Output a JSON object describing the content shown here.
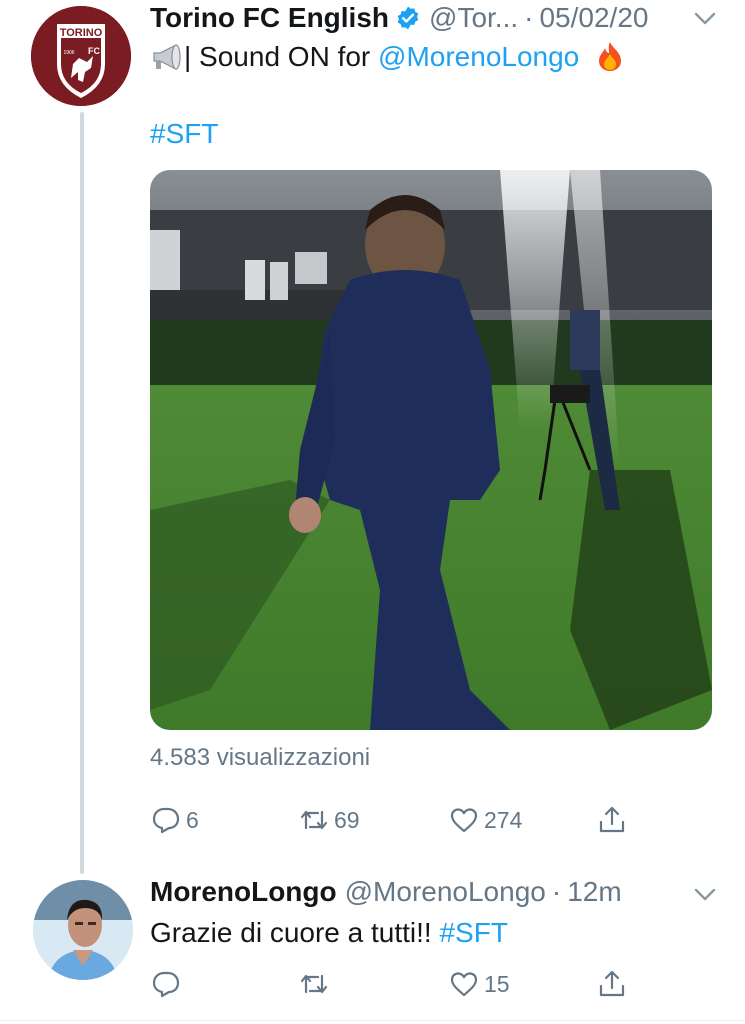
{
  "tweet1": {
    "display_name": "Torino FC English",
    "handle": "@Tor...",
    "date": "05/02/20",
    "text_prefix": "| Sound ON for ",
    "mention": "@MorenoLongo",
    "hashtag": "#SFT",
    "views": "4.583 visualizzazioni",
    "replies": "6",
    "retweets": "69",
    "likes": "274",
    "avatar_logo_text": "TORINO",
    "avatar_logo_fc": "FC",
    "avatar_logo_year": "1906"
  },
  "tweet2": {
    "display_name": "MorenoLongo",
    "handle": "@MorenoLongo",
    "date": "12m",
    "text": "Grazie di cuore a tutti!! ",
    "hashtag": "#SFT",
    "likes": "15"
  },
  "icons": {
    "verified": "verified-badge-icon",
    "megaphone": "megaphone-emoji",
    "fire": "fire-emoji",
    "reply": "reply-icon",
    "retweet": "retweet-icon",
    "like": "heart-icon",
    "share": "share-icon",
    "caret": "chevron-down-icon"
  },
  "colors": {
    "link": "#1da1f2",
    "muted": "#657786",
    "torino": "#7b1c22"
  }
}
